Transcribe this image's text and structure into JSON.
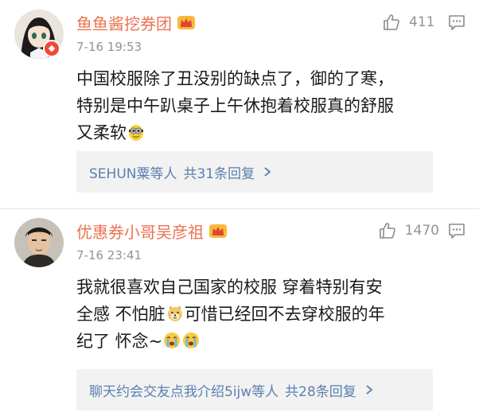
{
  "comments": [
    {
      "author": "鱼鱼酱挖券团",
      "time": "7-16 19:53",
      "likes": "411",
      "text_lines": [
        "中国校服除了丑没别的缺点了，御的了寒，",
        "特别是中午趴桌子上午休抱着校服真的舒服",
        "又柔软"
      ],
      "reply_who": "SEHUN粟",
      "reply_suffix": "等人",
      "reply_count": "共31条回复",
      "icons": [
        "avatar-anime",
        "verified-badge",
        "crown-icon",
        "thumb-up-icon",
        "comment-icon",
        "minion-emoji",
        "chevron-right-icon"
      ]
    },
    {
      "author": "优惠券小哥吴彦祖",
      "time": "7-16 23:41",
      "likes": "1470",
      "text_seg1": "我就很喜欢自己国家的校服 穿着特别有安",
      "text_seg2": "全感 不怕脏",
      "text_seg3": "可惜已经回不去穿校服的年",
      "text_seg4": "纪了 怀念~",
      "reply_who": "聊天约会交友点我介绍5ijw",
      "reply_suffix": "等人",
      "reply_count": "共28条回复",
      "icons": [
        "avatar-man",
        "crown-icon",
        "thumb-up-icon",
        "comment-icon",
        "doge-emoji",
        "crying-emoji",
        "chevron-right-icon"
      ]
    }
  ],
  "colors": {
    "name": "#eb7350",
    "link": "#5b7fb0",
    "meta": "#939393",
    "reply_bg": "#f2f2f2"
  }
}
